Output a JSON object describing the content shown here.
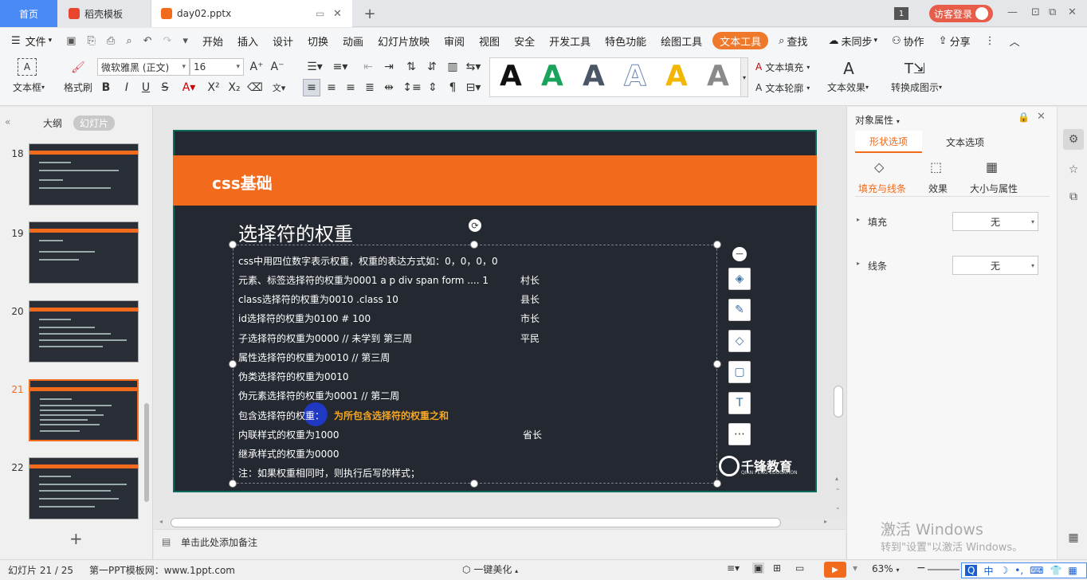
{
  "titlebar": {
    "home_tab": "首页",
    "template_tab": "稻壳模板",
    "doc_tab": "day02.pptx",
    "window_count": "1",
    "login": "访客登录"
  },
  "menu": {
    "file": "文件",
    "items": [
      "开始",
      "插入",
      "设计",
      "切换",
      "动画",
      "幻灯片放映",
      "审阅",
      "视图",
      "安全",
      "开发工具",
      "特色功能",
      "绘图工具"
    ],
    "text_tool": "文本工具",
    "search": "查找",
    "sync": "未同步",
    "collab": "协作",
    "share": "分享"
  },
  "ribbon": {
    "textbox": "文本框",
    "format_painter": "格式刷",
    "font_name": "微软雅黑 (正文)",
    "font_size": "16",
    "text_fill": "文本填充",
    "text_outline": "文本轮廓",
    "text_effect": "文本效果",
    "convert": "转换成图示",
    "style_colors": [
      "#111111",
      "#1aa35a",
      "#4a5566",
      "#6a86b8",
      "#f2b705",
      "#8a8a8a"
    ]
  },
  "left_panel": {
    "outline_tab": "大纲",
    "slides_tab": "幻灯片",
    "thumbs": [
      "18",
      "19",
      "20",
      "21",
      "22"
    ],
    "selected": "21"
  },
  "slide": {
    "section_title": "css基础",
    "heading": "选择符的权重",
    "lines": [
      "css中用四位数字表示权重，权重的表达方式如：0，0，0，0",
      "元素、标签选择符的权重为0001  a p div span form .... 1",
      "class选择符的权重为0010 .class 10",
      "id选择符的权重为0100   #   100",
      "子选择符的权重为0000 //      未学到     第三周",
      "属性选择符的权重为0010 //                第三周",
      "伪类选择符的权重为0010",
      "伪元素选择符的权重为0001 //              第二周",
      "包含选择符的权重：",
      "内联样式的权重为1000",
      "继承样式的权重为0000",
      "注：如果权重相同时，则执行后写的样式；"
    ],
    "highlight": "为所包含选择符的权重之和",
    "ranks": [
      "村长",
      "县长",
      "市长",
      "平民",
      "省长"
    ],
    "logo_text": "千锋教育",
    "logo_sub": "QIAN FENG EDUCATION"
  },
  "right_panel": {
    "title": "对象属性",
    "tab_shape": "形状选项",
    "tab_text": "文本选项",
    "sub_fill_line": "填充与线条",
    "sub_effect": "效果",
    "sub_size": "大小与属性",
    "fill_label": "填充",
    "fill_value": "无",
    "line_label": "线条",
    "line_value": "无",
    "watermark1": "激活 Windows",
    "watermark2": "转到\"设置\"以激活 Windows。"
  },
  "notes": {
    "placeholder": "单击此处添加备注"
  },
  "status": {
    "slide_pos": "幻灯片 21 / 25",
    "template": "第一PPT模板网：www.1ppt.com",
    "beautify": "一键美化",
    "zoom": "63%",
    "ime": "中"
  }
}
